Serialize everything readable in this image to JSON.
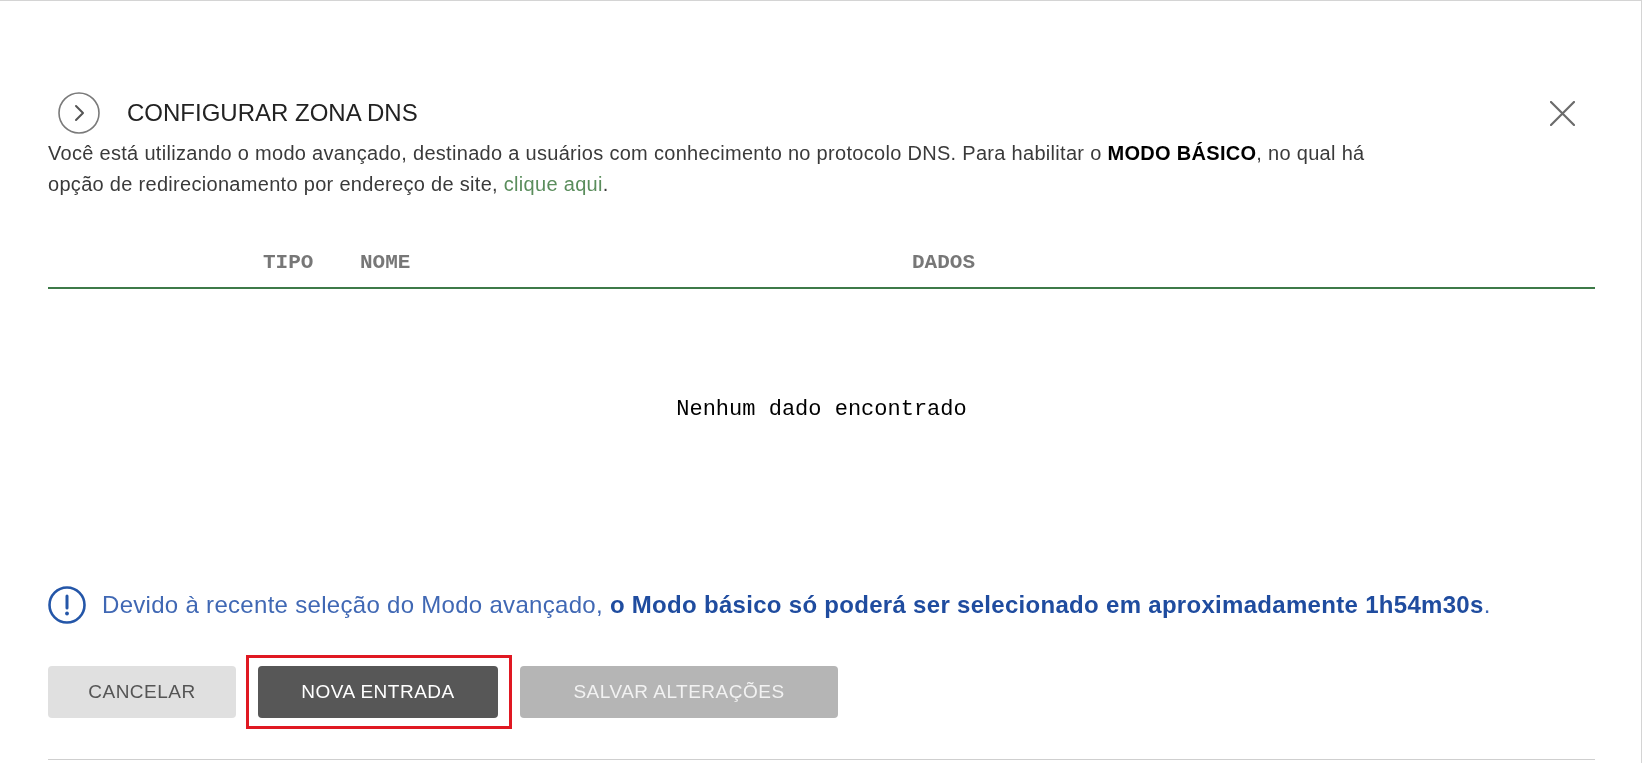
{
  "dialog": {
    "title": "CONFIGURAR ZONA DNS"
  },
  "intro": {
    "text": "Você está utilizando o modo avançado, destinado a usuários com conhecimento no protocolo DNS. Para habilitar o **MODO BÁSICO**, no qual há opção de redirecionamento por endereço de site, ",
    "link": "clique aqui",
    "text_after": "."
  },
  "table": {
    "columns": [
      "TIPO",
      "NOME",
      "DADOS"
    ],
    "empty_message": "Nenhum dado encontrado"
  },
  "alert": {
    "text": "Devido à recente seleção do Modo avançado, **o Modo básico só poderá ser selecionado em aproximadamente 1h54m30s**."
  },
  "buttons": [
    {
      "label": "CANCELAR",
      "kind": "secondary",
      "disabled": false,
      "highlighted": false
    },
    {
      "label": "NOVA ENTRADA",
      "kind": "primary",
      "disabled": false,
      "highlighted": true
    },
    {
      "label": "SALVAR ALTERAÇÕES",
      "kind": "primary",
      "disabled": true,
      "highlighted": false
    }
  ]
}
